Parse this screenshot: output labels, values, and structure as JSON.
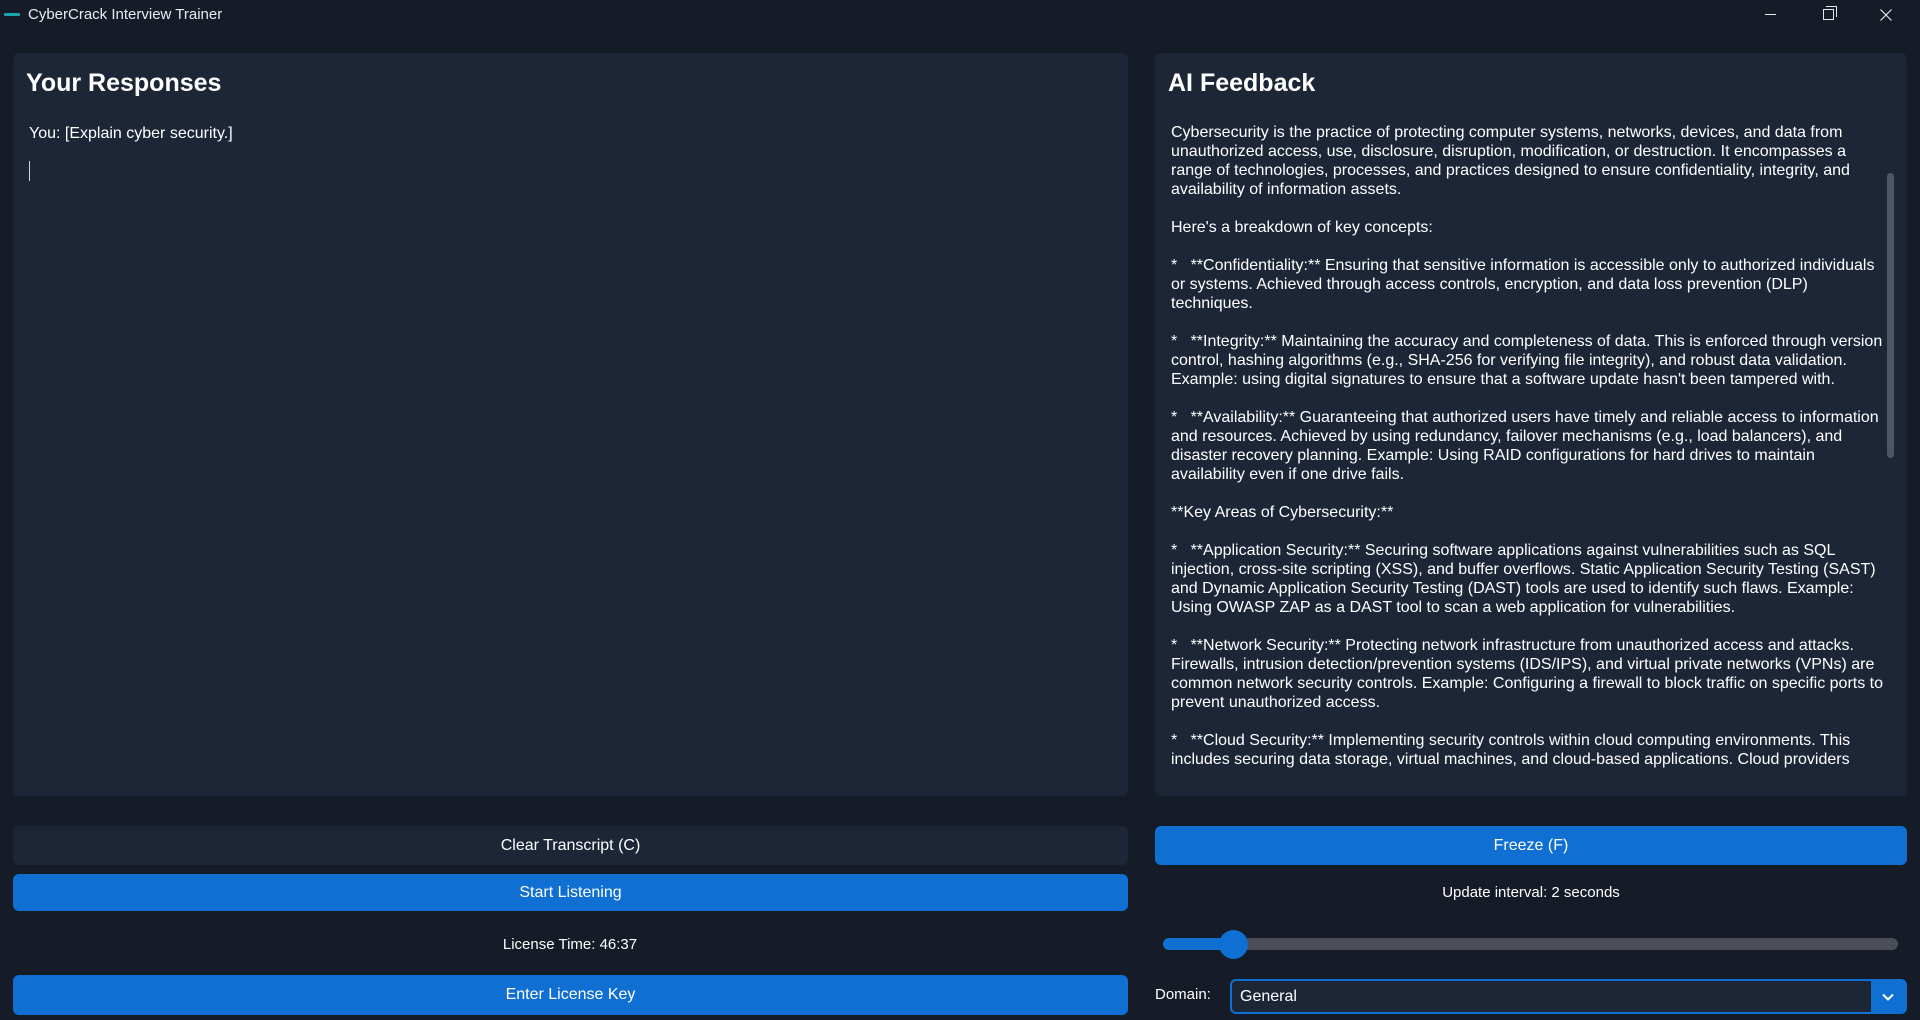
{
  "window": {
    "title": "CyberCrack Interview Trainer"
  },
  "responses": {
    "title": "Your Responses",
    "transcript": "You: [Explain cyber security.]"
  },
  "feedback": {
    "title": "AI Feedback",
    "paragraphs": [
      "Cybersecurity is the practice of protecting computer systems, networks, devices, and data from unauthorized access, use, disclosure, disruption, modification, or destruction. It encompasses a range of technologies, processes, and practices designed to ensure confidentiality, integrity, and availability of information assets.",
      "Here's a breakdown of key concepts:",
      "*   **Confidentiality:** Ensuring that sensitive information is accessible only to authorized individuals or systems. Achieved through access controls, encryption, and data loss prevention (DLP) techniques.",
      "*   **Integrity:** Maintaining the accuracy and completeness of data. This is enforced through version control, hashing algorithms (e.g., SHA-256 for verifying file integrity), and robust data validation. Example: using digital signatures to ensure that a software update hasn't been tampered with.",
      "*   **Availability:** Guaranteeing that authorized users have timely and reliable access to information and resources. Achieved by using redundancy, failover mechanisms (e.g., load balancers), and disaster recovery planning. Example: Using RAID configurations for hard drives to maintain availability even if one drive fails.",
      "**Key Areas of Cybersecurity:**",
      "*   **Application Security:** Securing software applications against vulnerabilities such as SQL injection, cross-site scripting (XSS), and buffer overflows. Static Application Security Testing (SAST) and Dynamic Application Security Testing (DAST) tools are used to identify such flaws. Example: Using OWASP ZAP as a DAST tool to scan a web application for vulnerabilities.",
      "*   **Network Security:** Protecting network infrastructure from unauthorized access and attacks. Firewalls, intrusion detection/prevention systems (IDS/IPS), and virtual private networks (VPNs) are common network security controls. Example: Configuring a firewall to block traffic on specific ports to prevent unauthorized access.",
      "*   **Cloud Security:** Implementing security controls within cloud computing environments. This includes securing data storage, virtual machines, and cloud-based applications. Cloud providers"
    ]
  },
  "controls": {
    "clear_label": "Clear Transcript (C)",
    "listen_label": "Start Listening",
    "license_time": "License Time: 46:37",
    "license_key_label": "Enter License Key",
    "freeze_label": "Freeze (F)",
    "interval_text": "Update interval: 2 seconds",
    "interval_slider_fraction": 0.095,
    "domain_label": "Domain:",
    "domain_value": "General"
  },
  "colors": {
    "accent": "#0f6fd3",
    "panel": "#1d2636",
    "background": "#151b27"
  }
}
